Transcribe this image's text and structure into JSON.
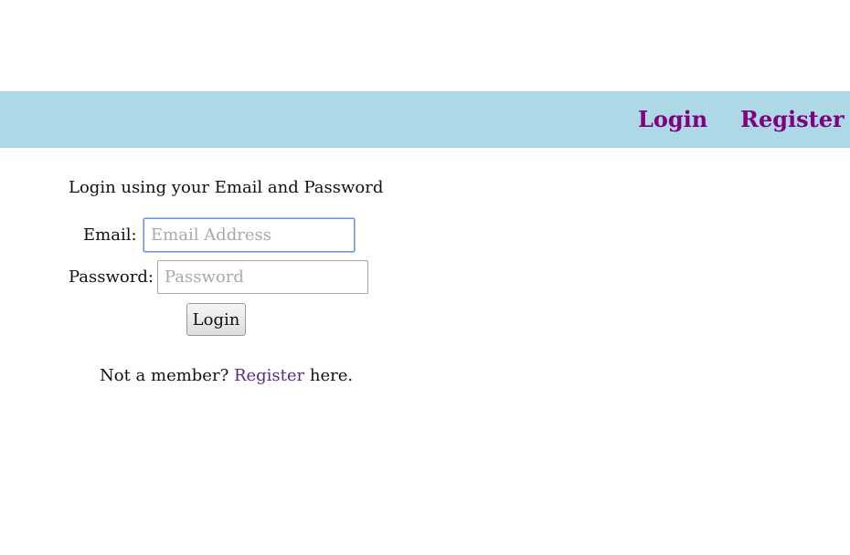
{
  "nav": {
    "login_label": "Login",
    "register_label": "Register"
  },
  "form": {
    "intro": "Login using your Email and Password",
    "email_label": "Email:",
    "email_placeholder": "Email Address",
    "email_value": "",
    "password_label": "Password:",
    "password_placeholder": "Password",
    "password_value": "",
    "submit_label": "Login"
  },
  "footer_note": {
    "prefix": "Not a member? ",
    "link_label": "Register",
    "suffix": " here."
  },
  "colors": {
    "navbar_bg": "#add8e6",
    "nav_link": "#800080",
    "inline_link": "#5a2a8a",
    "focus_border": "#6c8fe0"
  }
}
